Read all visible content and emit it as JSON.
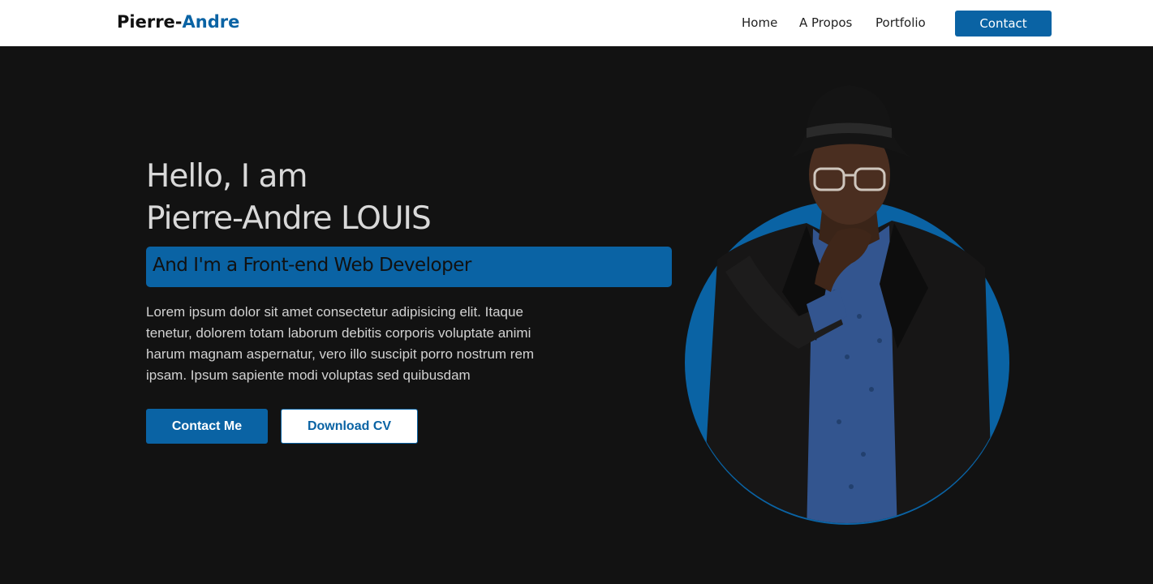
{
  "nav": {
    "logo_first": "Pierre-",
    "logo_accent": "Andre",
    "links": [
      {
        "label": "Home"
      },
      {
        "label": "A Propos"
      },
      {
        "label": "Portfolio"
      }
    ],
    "contact_label": "Contact"
  },
  "hero": {
    "greeting_line1": "Hello, I am",
    "greeting_line2": "Pierre-Andre LOUIS",
    "role": "And I'm a Front-end Web Developer",
    "intro": "Lorem ipsum dolor sit amet consectetur adipisicing elit. Itaque tenetur, dolorem totam laborum debitis corporis voluptate animi harum magnam aspernatur, vero illo suscipit porro nostrum rem ipsam. Ipsum sapiente modi voluptas sed quibusdam",
    "contact_button": "Contact Me",
    "cv_button": "Download CV"
  },
  "colors": {
    "accent": "#0a63a4",
    "background": "#121212",
    "navbar": "#ffffff"
  },
  "icons": {
    "portrait": "person-portrait"
  }
}
